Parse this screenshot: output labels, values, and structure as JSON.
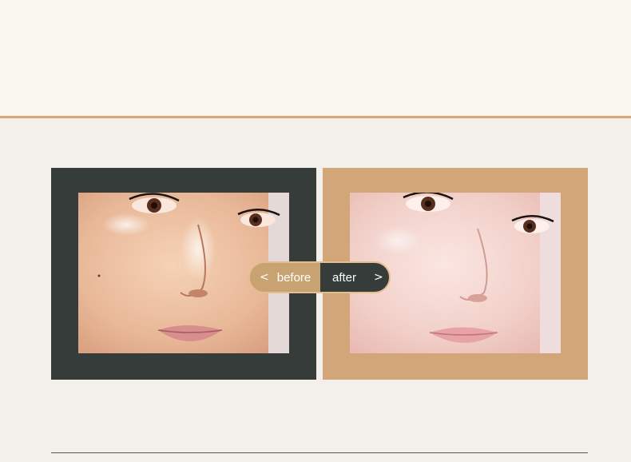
{
  "comparison": {
    "before_label": "before",
    "after_label": "after",
    "prev_glyph": "<",
    "next_glyph": ">",
    "selected": "after"
  },
  "colors": {
    "background": "#f3f0ec",
    "top_band": "#faf7f1",
    "accent_rule": "#d9a877",
    "before_frame": "#363c3a",
    "after_frame": "#d2a679"
  },
  "images": {
    "before_photo": "face-before-photo",
    "after_photo": "face-after-photo"
  }
}
